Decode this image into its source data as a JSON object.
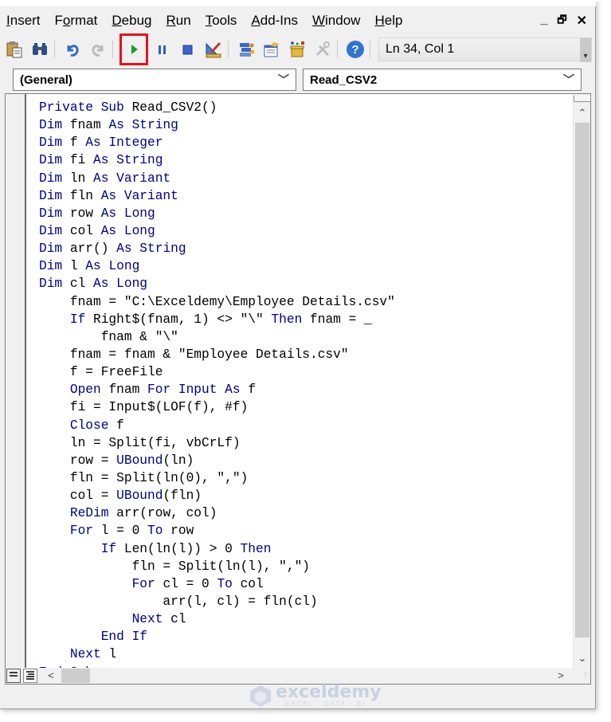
{
  "menubar": {
    "items": [
      {
        "label": "Insert",
        "accel": "I"
      },
      {
        "label": "Format",
        "accel": "o"
      },
      {
        "label": "Debug",
        "accel": "D"
      },
      {
        "label": "Run",
        "accel": "R"
      },
      {
        "label": "Tools",
        "accel": "T"
      },
      {
        "label": "Add-Ins",
        "accel": "A"
      },
      {
        "label": "Window",
        "accel": "W"
      },
      {
        "label": "Help",
        "accel": "H"
      }
    ],
    "window_controls": {
      "minimize": "_",
      "restore": "🗗",
      "close": "✕"
    }
  },
  "toolbar": {
    "buttons": [
      {
        "name": "paste-icon",
        "glyph": "📋"
      },
      {
        "name": "find-icon",
        "glyph": "🔭"
      },
      {
        "name": "undo-icon",
        "glyph": "↶"
      },
      {
        "name": "redo-icon",
        "glyph": "↷"
      },
      {
        "name": "run-icon",
        "glyph": "▶"
      },
      {
        "name": "break-icon",
        "glyph": "❚❚"
      },
      {
        "name": "reset-icon",
        "glyph": "■"
      },
      {
        "name": "design-mode-icon",
        "glyph": "📐"
      },
      {
        "name": "project-explorer-icon",
        "glyph": "🗂"
      },
      {
        "name": "properties-window-icon",
        "glyph": "📝"
      },
      {
        "name": "object-browser-icon",
        "glyph": "📦"
      },
      {
        "name": "toolbox-icon",
        "glyph": "🛠"
      },
      {
        "name": "help-icon",
        "glyph": "?"
      }
    ],
    "status": "Ln 34, Col 1",
    "highlight_color": "#e8111a"
  },
  "combos": {
    "object": "(General)",
    "procedure": "Read_CSV2"
  },
  "code": {
    "keyword_color": "#00008b",
    "lines": [
      [
        {
          "k": 1,
          "t": "Private Sub "
        },
        {
          "k": 0,
          "t": "Read_CSV2()"
        }
      ],
      [
        {
          "k": 1,
          "t": "Dim "
        },
        {
          "k": 0,
          "t": "fnam "
        },
        {
          "k": 1,
          "t": "As String"
        }
      ],
      [
        {
          "k": 1,
          "t": "Dim "
        },
        {
          "k": 0,
          "t": "f "
        },
        {
          "k": 1,
          "t": "As Integer"
        }
      ],
      [
        {
          "k": 1,
          "t": "Dim "
        },
        {
          "k": 0,
          "t": "fi "
        },
        {
          "k": 1,
          "t": "As String"
        }
      ],
      [
        {
          "k": 1,
          "t": "Dim "
        },
        {
          "k": 0,
          "t": "ln "
        },
        {
          "k": 1,
          "t": "As Variant"
        }
      ],
      [
        {
          "k": 1,
          "t": "Dim "
        },
        {
          "k": 0,
          "t": "fln "
        },
        {
          "k": 1,
          "t": "As Variant"
        }
      ],
      [
        {
          "k": 1,
          "t": "Dim "
        },
        {
          "k": 0,
          "t": "row "
        },
        {
          "k": 1,
          "t": "As Long"
        }
      ],
      [
        {
          "k": 1,
          "t": "Dim "
        },
        {
          "k": 0,
          "t": "col "
        },
        {
          "k": 1,
          "t": "As Long"
        }
      ],
      [
        {
          "k": 1,
          "t": "Dim "
        },
        {
          "k": 0,
          "t": "arr() "
        },
        {
          "k": 1,
          "t": "As String"
        }
      ],
      [
        {
          "k": 1,
          "t": "Dim "
        },
        {
          "k": 0,
          "t": "l "
        },
        {
          "k": 1,
          "t": "As Long"
        }
      ],
      [
        {
          "k": 1,
          "t": "Dim "
        },
        {
          "k": 0,
          "t": "cl "
        },
        {
          "k": 1,
          "t": "As Long"
        }
      ],
      [
        {
          "k": 0,
          "t": "    fnam = \"C:\\Exceldemy\\Employee Details.csv\""
        }
      ],
      [
        {
          "k": 1,
          "t": "    If "
        },
        {
          "k": 0,
          "t": "Right$(fnam, 1) <> \"\\\" "
        },
        {
          "k": 1,
          "t": "Then "
        },
        {
          "k": 0,
          "t": "fnam = _"
        }
      ],
      [
        {
          "k": 0,
          "t": "        fnam & \"\\\""
        }
      ],
      [
        {
          "k": 0,
          "t": "    fnam = fnam & \"Employee Details.csv\""
        }
      ],
      [
        {
          "k": 0,
          "t": "    f = FreeFile"
        }
      ],
      [
        {
          "k": 1,
          "t": "    Open "
        },
        {
          "k": 0,
          "t": "fnam "
        },
        {
          "k": 1,
          "t": "For Input As "
        },
        {
          "k": 0,
          "t": "f"
        }
      ],
      [
        {
          "k": 0,
          "t": "    fi = Input$(LOF(f), #f)"
        }
      ],
      [
        {
          "k": 1,
          "t": "    Close "
        },
        {
          "k": 0,
          "t": "f"
        }
      ],
      [
        {
          "k": 0,
          "t": "    ln = Split(fi, vbCrLf)"
        }
      ],
      [
        {
          "k": 0,
          "t": "    row = "
        },
        {
          "k": 1,
          "t": "UBound"
        },
        {
          "k": 0,
          "t": "(ln)"
        }
      ],
      [
        {
          "k": 0,
          "t": "    fln = Split(ln(0), \",\")"
        }
      ],
      [
        {
          "k": 0,
          "t": "    col = "
        },
        {
          "k": 1,
          "t": "UBound"
        },
        {
          "k": 0,
          "t": "(fln)"
        }
      ],
      [
        {
          "k": 1,
          "t": "    ReDim "
        },
        {
          "k": 0,
          "t": "arr(row, col)"
        }
      ],
      [
        {
          "k": 1,
          "t": "    For "
        },
        {
          "k": 0,
          "t": "l = 0 "
        },
        {
          "k": 1,
          "t": "To "
        },
        {
          "k": 0,
          "t": "row"
        }
      ],
      [
        {
          "k": 1,
          "t": "        If "
        },
        {
          "k": 0,
          "t": "Len(ln(l)) > 0 "
        },
        {
          "k": 1,
          "t": "Then"
        }
      ],
      [
        {
          "k": 0,
          "t": "            fln = Split(ln(l), \",\")"
        }
      ],
      [
        {
          "k": 1,
          "t": "            For "
        },
        {
          "k": 0,
          "t": "cl = 0 "
        },
        {
          "k": 1,
          "t": "To "
        },
        {
          "k": 0,
          "t": "col"
        }
      ],
      [
        {
          "k": 0,
          "t": "                arr(l, cl) = fln(cl)"
        }
      ],
      [
        {
          "k": 1,
          "t": "            Next "
        },
        {
          "k": 0,
          "t": "cl"
        }
      ],
      [
        {
          "k": 1,
          "t": "        End If"
        }
      ],
      [
        {
          "k": 1,
          "t": "    Next "
        },
        {
          "k": 0,
          "t": "l"
        }
      ],
      [
        {
          "k": 1,
          "t": "End Sub"
        }
      ]
    ]
  },
  "scrollbars": {
    "up": "⌃",
    "down": "⌄",
    "left": "<",
    "right": ">"
  },
  "view_buttons": {
    "procedure_view": "☰",
    "full_module_view": "☷"
  },
  "watermark": {
    "brand": "exceldemy",
    "tagline": "EXCEL · DATA · BI"
  }
}
